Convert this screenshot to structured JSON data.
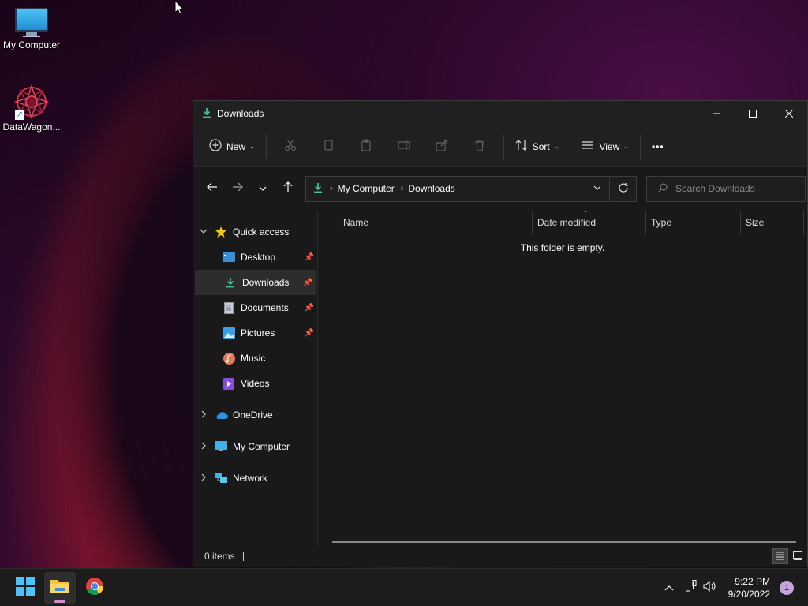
{
  "desktop": {
    "icons": [
      {
        "label": "My Computer"
      },
      {
        "label": "DataWagon..."
      }
    ]
  },
  "window": {
    "title": "Downloads",
    "controls": {
      "minimize": "–",
      "maximize": "☐",
      "close": "✕"
    }
  },
  "toolbar": {
    "new_label": "New",
    "sort_label": "Sort",
    "view_label": "View",
    "more_label": "•••"
  },
  "address": {
    "crumbs": [
      "My Computer",
      "Downloads"
    ]
  },
  "search": {
    "placeholder": "Search Downloads"
  },
  "nav": {
    "quick_access": "Quick access",
    "items": [
      {
        "label": "Desktop",
        "pinned": true
      },
      {
        "label": "Downloads",
        "pinned": true,
        "selected": true
      },
      {
        "label": "Documents",
        "pinned": true
      },
      {
        "label": "Pictures",
        "pinned": true
      },
      {
        "label": "Music",
        "pinned": false
      },
      {
        "label": "Videos",
        "pinned": false
      }
    ],
    "onedrive": "OneDrive",
    "my_computer": "My Computer",
    "network": "Network"
  },
  "columns": {
    "name": "Name",
    "date_modified": "Date modified",
    "type": "Type",
    "size": "Size"
  },
  "content": {
    "empty_message": "This folder is empty."
  },
  "status": {
    "items_count": "0 items"
  },
  "taskbar": {
    "time": "9:22 PM",
    "date": "9/20/2022",
    "notification_count": "1"
  },
  "colors": {
    "accent": "#4cc2ff",
    "download_green": "#3ec28f",
    "window_bg": "#191919",
    "taskbar_bg": "#1c1c1c"
  }
}
